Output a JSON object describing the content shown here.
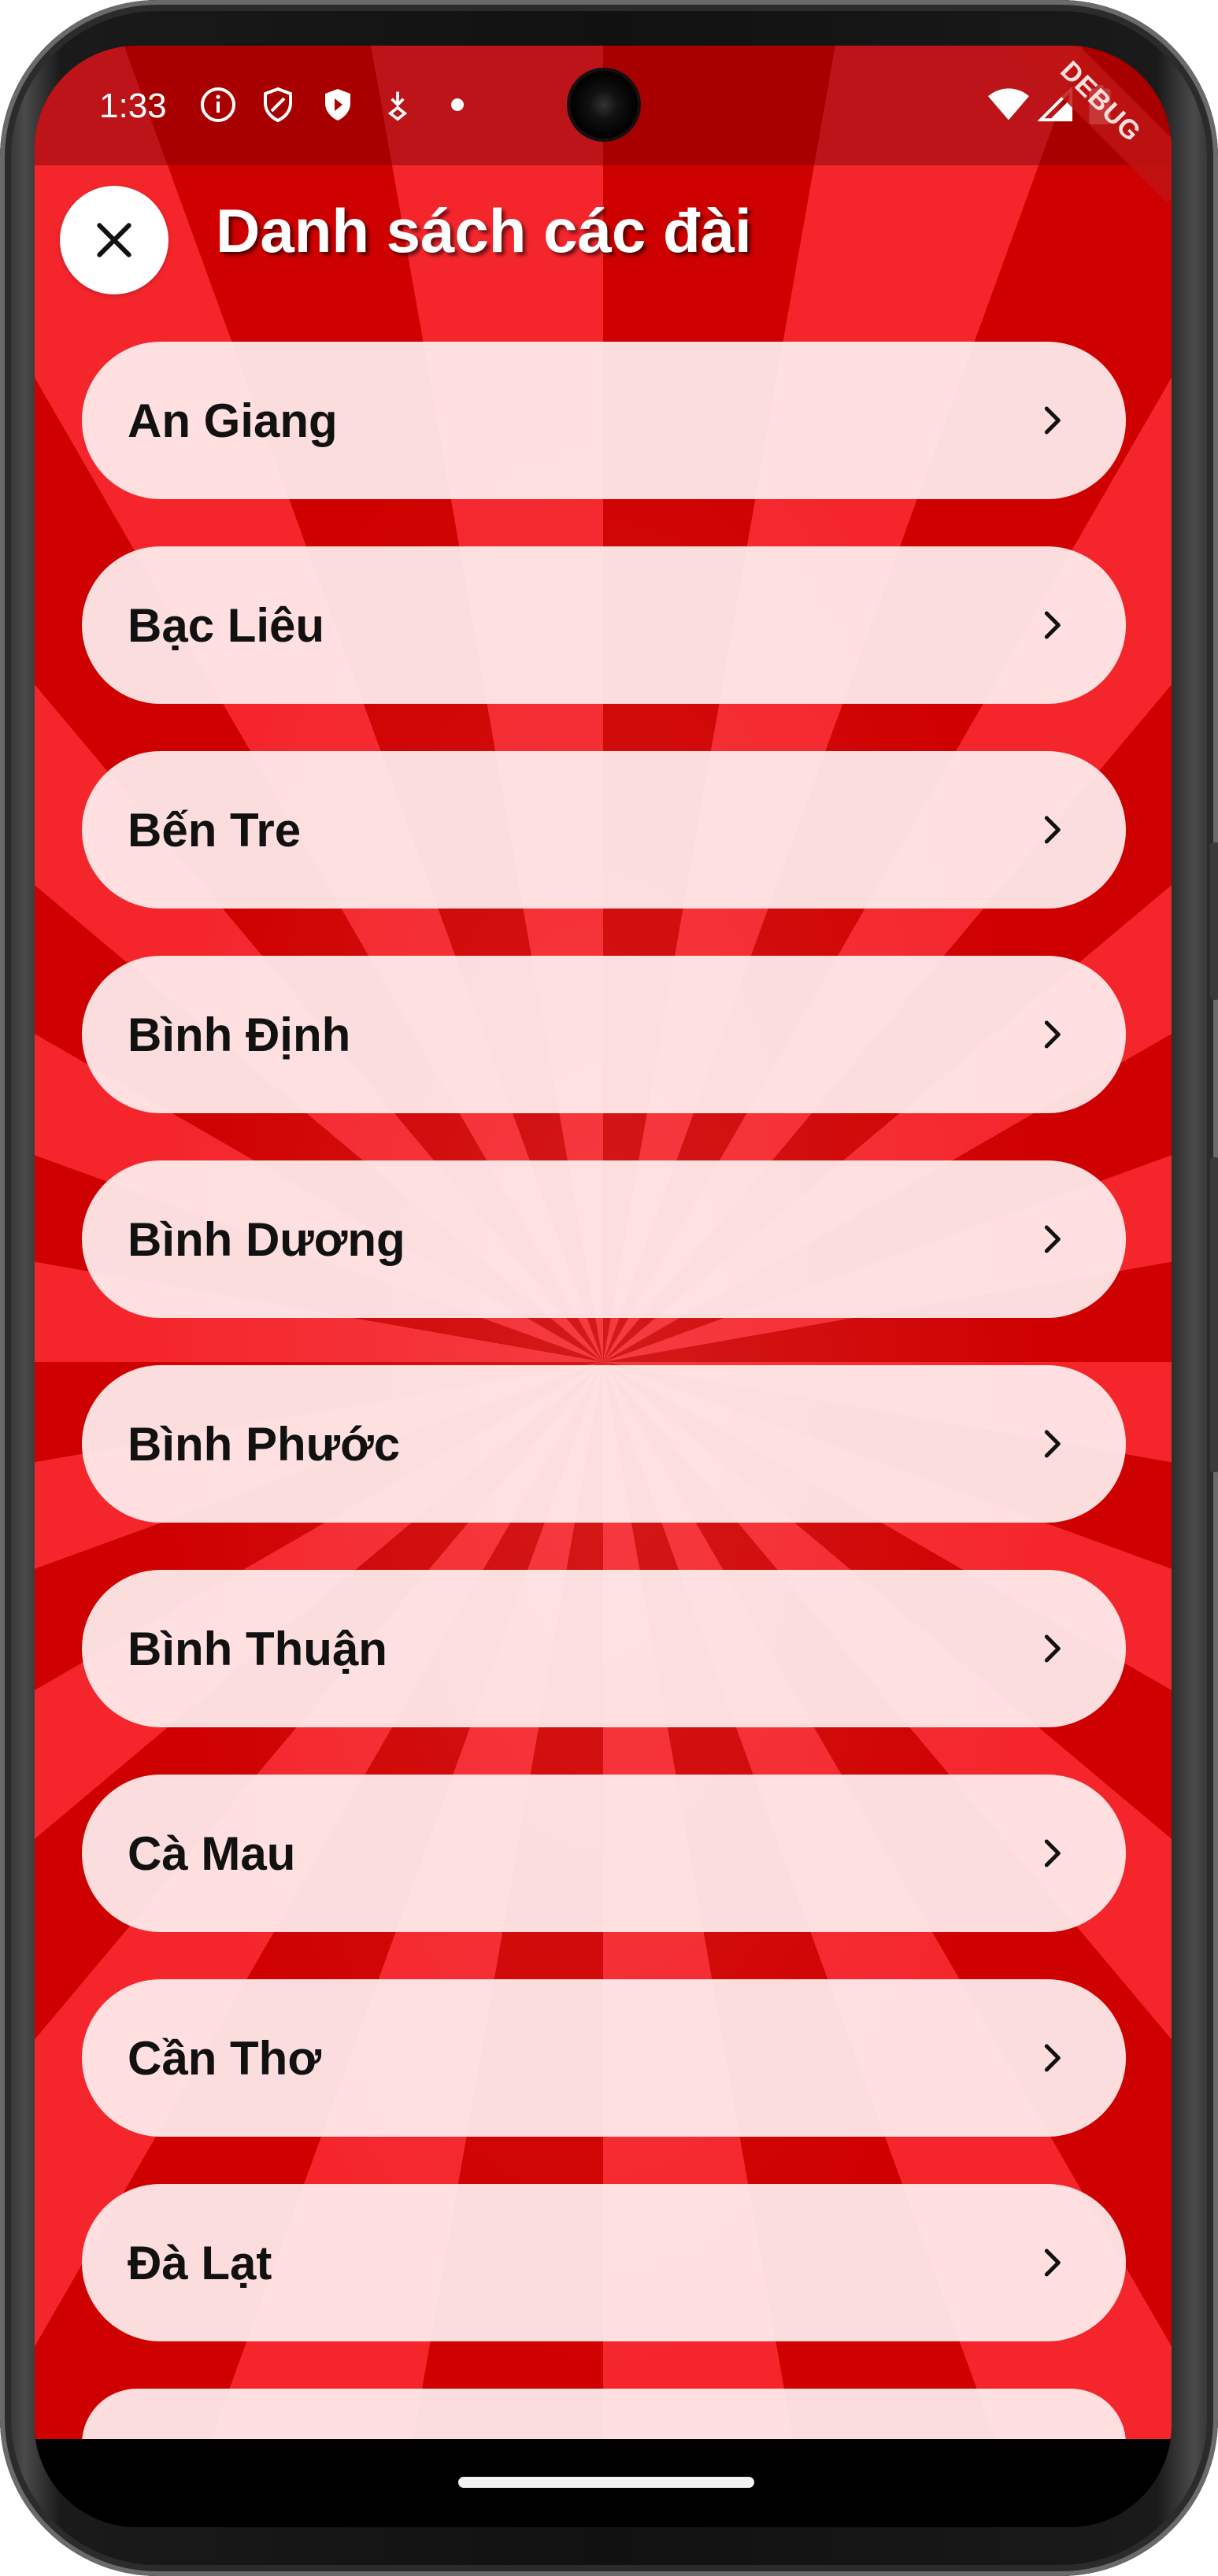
{
  "status_bar": {
    "time": "1:33",
    "debug_label": "DEBUG",
    "icons": [
      "info-icon",
      "shield-icon",
      "shield-filled-icon",
      "download-icon",
      "dot-icon",
      "wifi-icon",
      "signal-icon",
      "battery-icon"
    ]
  },
  "header": {
    "title": "Danh sách các đài",
    "close_icon": "close-icon"
  },
  "stations": [
    {
      "label": "An Giang"
    },
    {
      "label": "Bạc Liêu"
    },
    {
      "label": "Bến Tre"
    },
    {
      "label": "Bình Định"
    },
    {
      "label": "Bình Dương"
    },
    {
      "label": "Bình Phước"
    },
    {
      "label": "Bình Thuận"
    },
    {
      "label": "Cà Mau"
    },
    {
      "label": "Cần Thơ"
    },
    {
      "label": "Đà Lạt"
    }
  ],
  "colors": {
    "background_red_dark": "#cf0000",
    "background_red_light": "#f4262c",
    "list_item_bg": "#ffeeee",
    "title_text": "#ffffff",
    "item_text": "#111111"
  }
}
